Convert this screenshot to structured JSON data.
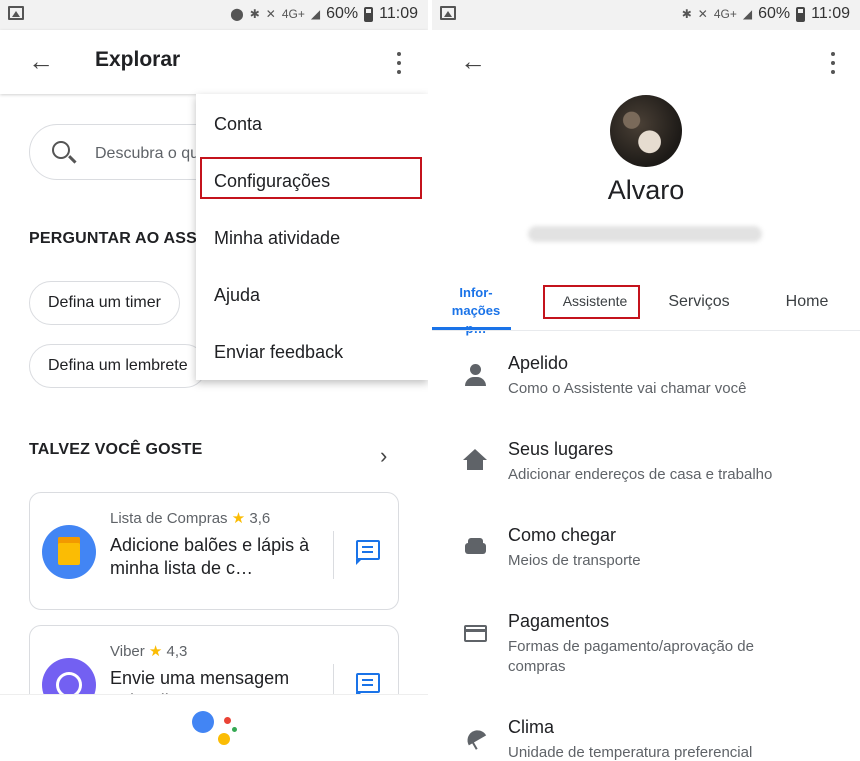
{
  "status": {
    "network": "4G+",
    "battery": "60%",
    "time": "11:09"
  },
  "left": {
    "title": "Explorar",
    "search_placeholder": "Descubra o que",
    "section1": "PERGUNTAR AO ASSISTENTE",
    "chips": [
      "Defina um timer",
      "Defina um lembrete"
    ],
    "section2": "TALVEZ VOCÊ GOSTE",
    "cards": [
      {
        "app": "Lista de Compras",
        "rating": "3,6",
        "desc": "Adicione balões e lápis à minha lista de c…"
      },
      {
        "app": "Viber",
        "rating": "4,3",
        "desc": "Envie uma mensagem pelo Viber"
      }
    ],
    "menu": [
      "Conta",
      "Configurações",
      "Minha atividade",
      "Ajuda",
      "Enviar feedback"
    ],
    "assistant_colors": [
      "#4285f4",
      "#ea4335",
      "#fbbc04",
      "#34a853"
    ]
  },
  "right": {
    "name": "Alvaro",
    "tabs": [
      "Infor-\nmações p…",
      "Assistente",
      "Serviços",
      "Home"
    ],
    "rows": [
      {
        "icon": "person-icon",
        "title": "Apelido",
        "sub": "Como o Assistente vai chamar você"
      },
      {
        "icon": "home-icon",
        "title": "Seus lugares",
        "sub": "Adicionar endereços de casa e trabalho"
      },
      {
        "icon": "car-icon",
        "title": "Como chegar",
        "sub": "Meios de transporte"
      },
      {
        "icon": "credit-card-icon",
        "title": "Pagamentos",
        "sub": "Formas de pagamento/aprovação de compras"
      },
      {
        "icon": "weather-icon",
        "title": "Clima",
        "sub": "Unidade de temperatura preferencial"
      }
    ]
  },
  "colors": {
    "accent": "#1a73e8",
    "highlight": "#c4131c",
    "star": "#fbbc04"
  }
}
